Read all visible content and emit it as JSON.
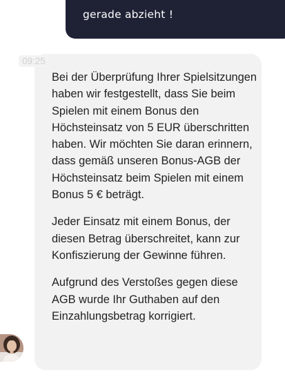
{
  "user_message": {
    "text": "gerade abzieht !"
  },
  "agent_message": {
    "timestamp": "09:25",
    "paragraphs": [
      "Bei der Überprüfung Ihrer Spielsitzungen haben wir festgestellt, dass Sie beim Spielen mit einem Bonus den Höchsteinsatz von 5 EUR überschritten haben. Wir möchten Sie daran erinnern, dass gemäß unseren Bonus-AGB der Höchsteinsatz beim Spielen mit einem Bonus 5 € beträgt.",
      "Jeder Einsatz mit einem Bonus, der diesen Betrag überschreitet, kann zur Konfiszierung der Gewinne führen.",
      "Aufgrund des Verstoßes gegen diese AGB wurde Ihr Guthaben auf den Einzahlungsbetrag korrigiert."
    ]
  },
  "colors": {
    "user_bubble": "#1f2235",
    "agent_bubble": "#f2f2f2",
    "text": "#222222"
  },
  "icons": {
    "avatar": "agent-avatar-photo"
  }
}
